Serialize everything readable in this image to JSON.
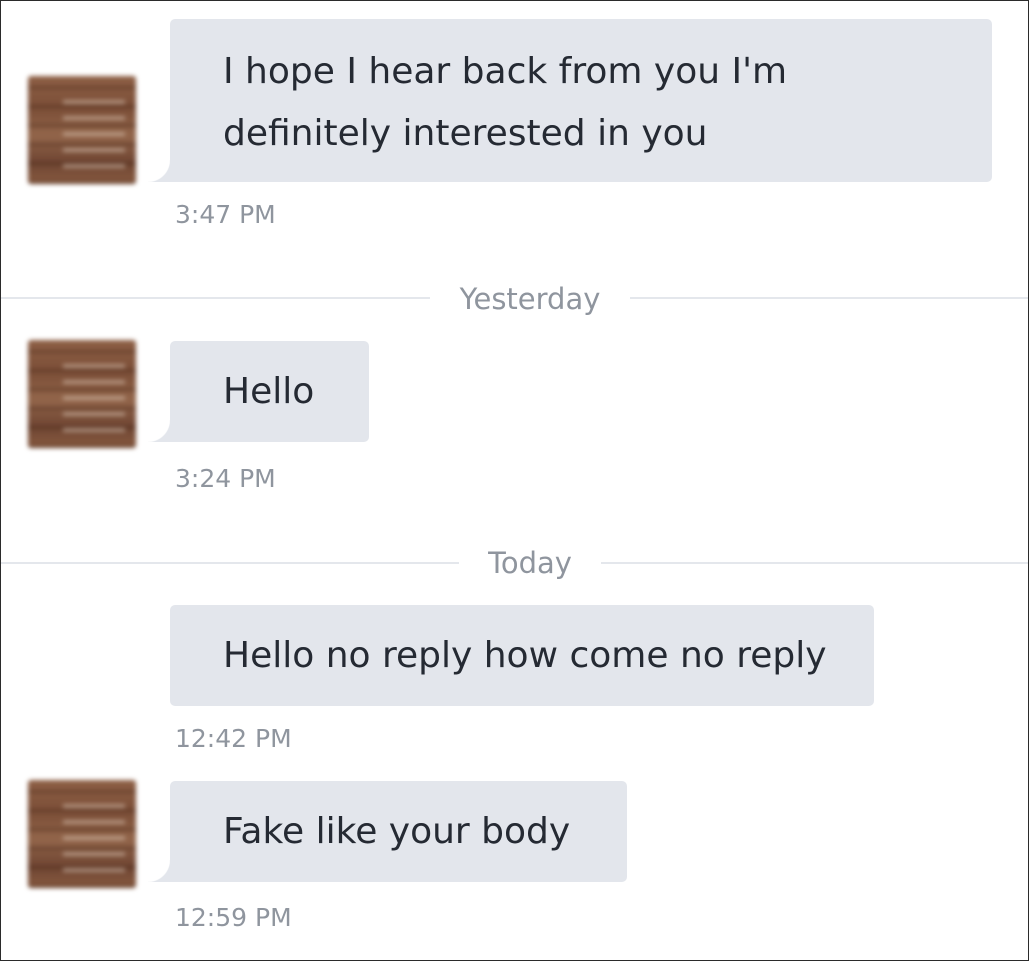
{
  "conversation": {
    "messages": [
      {
        "text": "I hope I hear back from you I'm definitely interested in you",
        "line1": "I hope I hear back from you I'm",
        "line2": "definitely interested in you",
        "time": "3:47 PM"
      },
      {
        "text": "Hello",
        "time": "3:24 PM"
      },
      {
        "text": "Hello no reply how come no reply",
        "time": "12:42 PM"
      },
      {
        "text": "Fake like your body",
        "time": "12:59 PM"
      }
    ],
    "separators": [
      {
        "label": "Yesterday"
      },
      {
        "label": "Today"
      }
    ]
  },
  "colors": {
    "bubble": "#e3e6ec",
    "message_text": "#252a33",
    "muted_text": "#8f959e",
    "divider": "#e4e7ec"
  }
}
